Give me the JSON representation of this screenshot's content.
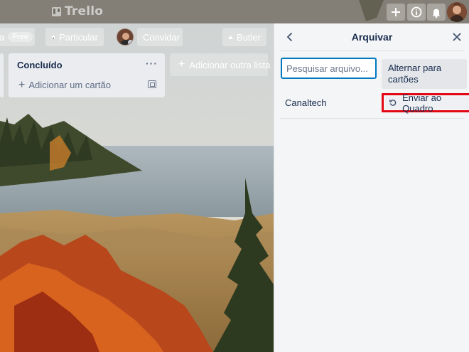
{
  "topbar": {
    "logo": "Trello",
    "icons": [
      "plus-icon",
      "info-icon",
      "bell-icon"
    ]
  },
  "board_header": {
    "partial_text": "a",
    "free_badge": "Free",
    "visibility_label": "Particular",
    "invite_label": "Convidar",
    "butler_label": "Butler"
  },
  "lists": [
    {
      "title": "Concluído",
      "menu": "···",
      "add_card_label": "Adicionar um cartão"
    }
  ],
  "add_list_label": "Adicionar outra lista",
  "archive_panel": {
    "title": "Arquivar",
    "search_placeholder": "Pesquisar arquivo...",
    "toggle_label": "Alternar para cartões",
    "items": [
      {
        "name": "Canaltech",
        "restore_label": "Enviar ao Quadro"
      }
    ]
  },
  "colors": {
    "accent": "#0079bf",
    "highlight": "#e30613",
    "panel_bg": "#f4f5f7",
    "list_bg": "#ebecf0"
  }
}
